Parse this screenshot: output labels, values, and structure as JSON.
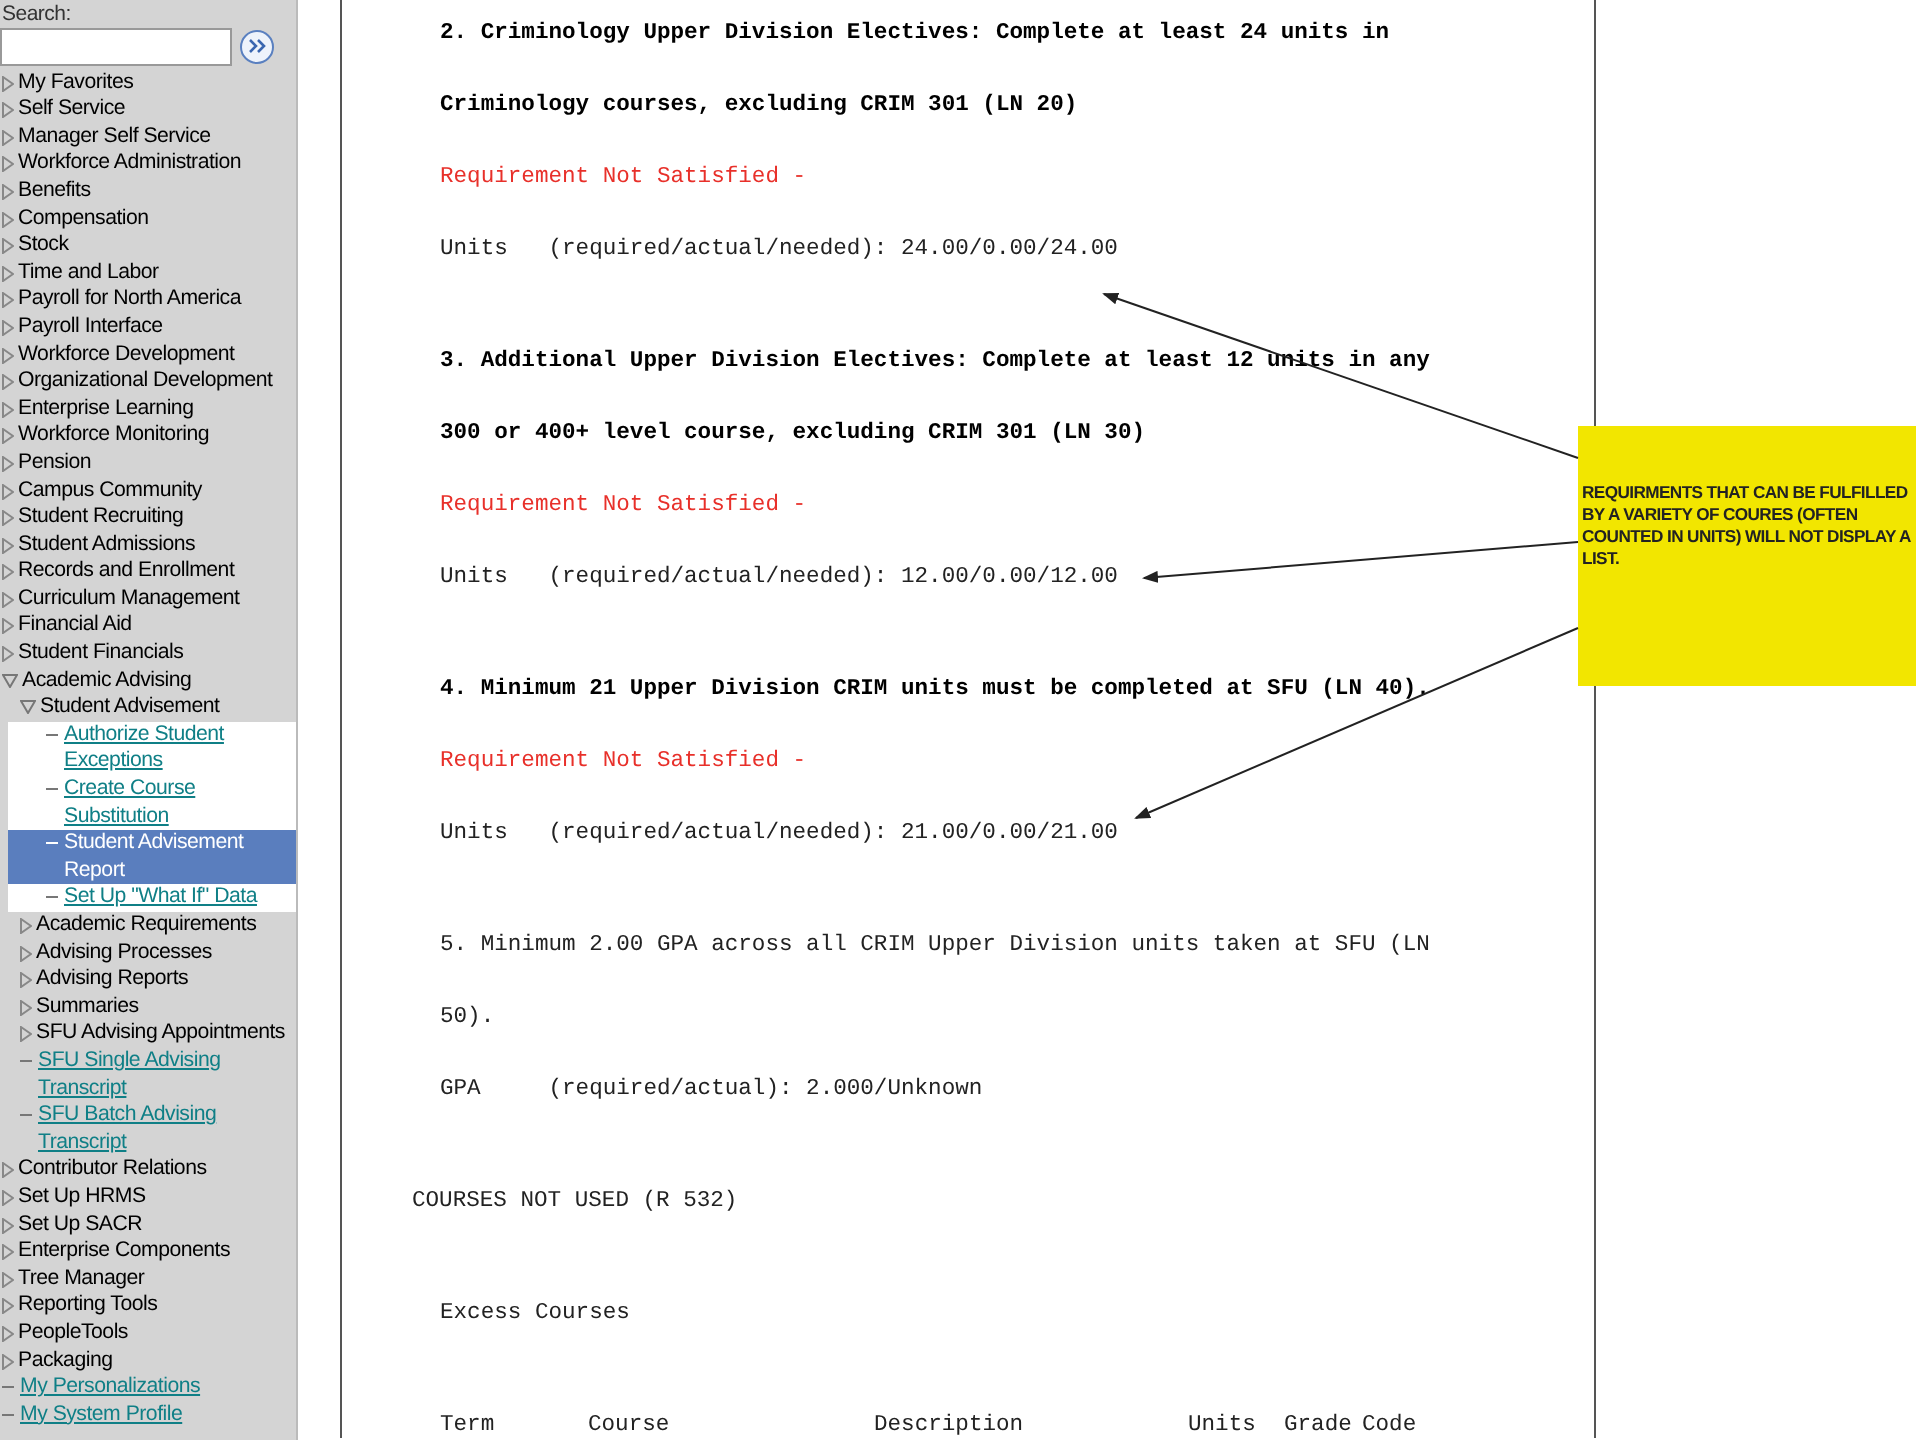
{
  "sidebar": {
    "search_label": "Search:",
    "items": [
      {
        "label": "My Favorites",
        "kind": "folder",
        "expanded": false,
        "selected": false
      },
      {
        "label": "Self Service",
        "kind": "folder",
        "expanded": false,
        "selected": false
      },
      {
        "label": "Manager Self Service",
        "kind": "folder",
        "expanded": false,
        "selected": false
      },
      {
        "label": "Workforce Administration",
        "kind": "folder",
        "expanded": false,
        "selected": false
      },
      {
        "label": "Benefits",
        "kind": "folder",
        "expanded": false,
        "selected": false
      },
      {
        "label": "Compensation",
        "kind": "folder",
        "expanded": false,
        "selected": false
      },
      {
        "label": "Stock",
        "kind": "folder",
        "expanded": false,
        "selected": false
      },
      {
        "label": "Time and Labor",
        "kind": "folder",
        "expanded": false,
        "selected": false
      },
      {
        "label": "Payroll for North America",
        "kind": "folder",
        "expanded": false,
        "selected": false
      },
      {
        "label": "Payroll Interface",
        "kind": "folder",
        "expanded": false,
        "selected": false
      },
      {
        "label": "Workforce Development",
        "kind": "folder",
        "expanded": false,
        "selected": false
      },
      {
        "label": "Organizational Development",
        "kind": "folder",
        "expanded": false,
        "selected": false
      },
      {
        "label": "Enterprise Learning",
        "kind": "folder",
        "expanded": false,
        "selected": false
      },
      {
        "label": "Workforce Monitoring",
        "kind": "folder",
        "expanded": false,
        "selected": false
      },
      {
        "label": "Pension",
        "kind": "folder",
        "expanded": false,
        "selected": false
      },
      {
        "label": "Campus Community",
        "kind": "folder",
        "expanded": false,
        "selected": false
      },
      {
        "label": "Student Recruiting",
        "kind": "folder",
        "expanded": false,
        "selected": false
      },
      {
        "label": "Student Admissions",
        "kind": "folder",
        "expanded": false,
        "selected": false
      },
      {
        "label": "Records and Enrollment",
        "kind": "folder",
        "expanded": false,
        "selected": false
      },
      {
        "label": "Curriculum Management",
        "kind": "folder",
        "expanded": false,
        "selected": false
      },
      {
        "label": "Financial Aid",
        "kind": "folder",
        "expanded": false,
        "selected": false
      },
      {
        "label": "Student Financials",
        "kind": "folder",
        "expanded": false,
        "selected": false
      },
      {
        "label": "Academic Advising",
        "kind": "folder",
        "expanded": true,
        "selected": false,
        "children": [
          {
            "label": "Student Advisement",
            "kind": "folder",
            "expanded": true,
            "selected": false,
            "children": [
              {
                "label": "Authorize Student Exceptions",
                "kind": "link",
                "selected": false
              },
              {
                "label": "Create Course Substitution",
                "kind": "link",
                "selected": false
              },
              {
                "label": "Student Advisement Report",
                "kind": "link",
                "selected": true
              },
              {
                "label": "Set Up \"What If\" Data",
                "kind": "link",
                "selected": false
              }
            ]
          },
          {
            "label": "Academic Requirements",
            "kind": "folder",
            "expanded": false,
            "selected": false
          },
          {
            "label": "Advising Processes",
            "kind": "folder",
            "expanded": false,
            "selected": false
          },
          {
            "label": "Advising Reports",
            "kind": "folder",
            "expanded": false,
            "selected": false
          },
          {
            "label": "Summaries",
            "kind": "folder",
            "expanded": false,
            "selected": false
          },
          {
            "label": "SFU Advising Appointments",
            "kind": "folder",
            "expanded": false,
            "selected": false
          },
          {
            "label": "SFU Single Advising Transcript",
            "kind": "link",
            "selected": false
          },
          {
            "label": "SFU Batch Advising Transcript",
            "kind": "link",
            "selected": false
          }
        ]
      },
      {
        "label": "Contributor Relations",
        "kind": "folder",
        "expanded": false,
        "selected": false
      },
      {
        "label": "Set Up HRMS",
        "kind": "folder",
        "expanded": false,
        "selected": false
      },
      {
        "label": "Set Up SACR",
        "kind": "folder",
        "expanded": false,
        "selected": false
      },
      {
        "label": "Enterprise Components",
        "kind": "folder",
        "expanded": false,
        "selected": false
      },
      {
        "label": "Tree Manager",
        "kind": "folder",
        "expanded": false,
        "selected": false
      },
      {
        "label": "Reporting Tools",
        "kind": "folder",
        "expanded": false,
        "selected": false
      },
      {
        "label": "PeopleTools",
        "kind": "folder",
        "expanded": false,
        "selected": false
      },
      {
        "label": "Packaging",
        "kind": "folder",
        "expanded": false,
        "selected": false
      },
      {
        "label": "My Personalizations",
        "kind": "link",
        "selected": false
      },
      {
        "label": "My System Profile",
        "kind": "link",
        "selected": false
      }
    ]
  },
  "report": {
    "blocks": [
      {
        "lines": [
          {
            "kind": "heading",
            "text": "2. Criminology Upper Division Electives: Complete at least 24 units in"
          },
          {
            "kind": "heading",
            "text": "Criminology courses, excluding CRIM 301 (LN 20)"
          },
          {
            "kind": "status",
            "text": "Requirement Not Satisfied -"
          },
          {
            "kind": "plain",
            "text": "Units   (required/actual/needed): 24.00/0.00/24.00"
          }
        ]
      },
      {
        "lines": [
          {
            "kind": "heading",
            "text": "3. Additional Upper Division Electives: Complete at least 12 units in any"
          },
          {
            "kind": "heading",
            "text": "300 or 400+ level course, excluding CRIM 301 (LN 30)"
          },
          {
            "kind": "status",
            "text": "Requirement Not Satisfied -"
          },
          {
            "kind": "plain",
            "text": "Units   (required/actual/needed): 12.00/0.00/12.00"
          }
        ]
      },
      {
        "lines": [
          {
            "kind": "heading",
            "text": "4. Minimum 21 Upper Division CRIM units must be completed at SFU (LN 40)."
          },
          {
            "kind": "status",
            "text": "Requirement Not Satisfied -"
          },
          {
            "kind": "plain",
            "text": "Units   (required/actual/needed): 21.00/0.00/21.00"
          }
        ]
      },
      {
        "lines": [
          {
            "kind": "plain",
            "text": "5. Minimum 2.00 GPA across all CRIM Upper Division units taken at SFU (LN"
          },
          {
            "kind": "plain",
            "text": "50)."
          },
          {
            "kind": "plain",
            "text": "GPA     (required/actual): 2.000/Unknown"
          }
        ]
      },
      {
        "lines": [
          {
            "kind": "section",
            "text": "COURSES NOT USED (R 532)"
          }
        ]
      },
      {
        "lines": [
          {
            "kind": "plain",
            "text": "Excess Courses"
          }
        ]
      }
    ],
    "table": {
      "columns": [
        "Term",
        "Course",
        "Description",
        "Units",
        "Grade",
        "Code"
      ]
    }
  },
  "callout": {
    "text": "REQUIRMENTS THAT CAN BE FULFILLED BY A VARIETY OF COURES (OFTEN COUNTED IN UNITS) WILL NOT DISPLAY A LIST."
  }
}
